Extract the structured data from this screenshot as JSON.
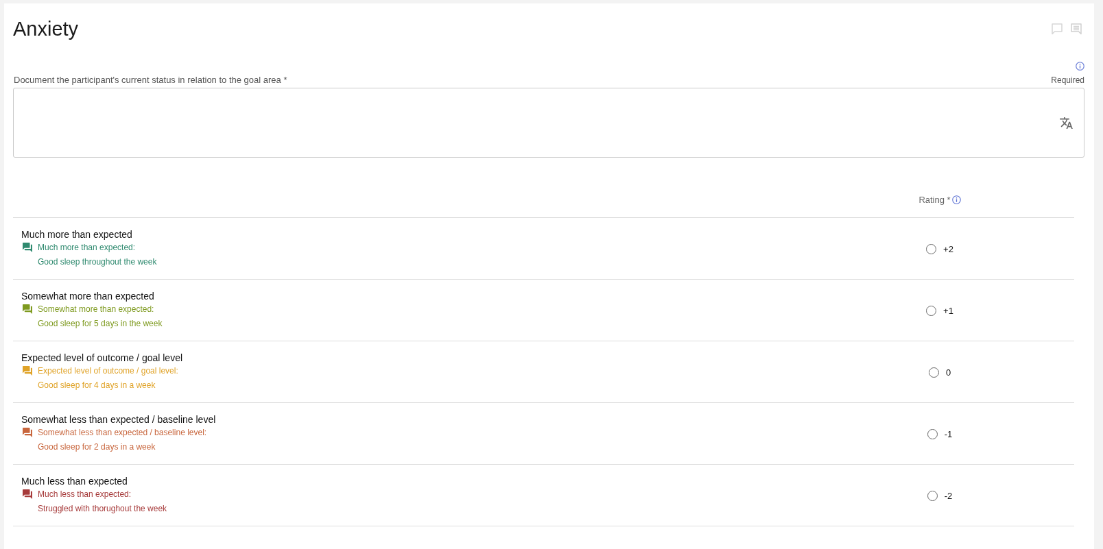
{
  "title": "Anxiety",
  "status_field": {
    "label": "Document the participant's current status in relation to the goal area *",
    "required_note": "Required"
  },
  "rating_table": {
    "column_header": "Rating *",
    "levels": [
      {
        "description": "Much more than expected",
        "note_label": "Much more than expected:",
        "note_text": "Good sleep throughout the week",
        "color": "#2f8a6f",
        "rating": {
          "label": "+2",
          "selected": false
        }
      },
      {
        "description": "Somewhat more than expected",
        "note_label": "Somewhat more than expected:",
        "note_text": "Good sleep for 5 days in the week",
        "color": "#7e9a1f",
        "rating": {
          "label": "+1",
          "selected": false
        }
      },
      {
        "description": "Expected level of outcome / goal level",
        "note_label": "Expected level of outcome / goal level:",
        "note_text": "Good sleep for 4 days in a week",
        "color": "#e0a328",
        "rating": {
          "label": "0",
          "selected": false
        }
      },
      {
        "description": "Somewhat less than expected / baseline level",
        "note_label": "Somewhat less than expected / baseline level:",
        "note_text": "Good sleep for 2 days in a week",
        "color": "#c8663d",
        "rating": {
          "label": "-1",
          "selected": false
        }
      },
      {
        "description": "Much less than expected",
        "note_label": "Much less than expected:",
        "note_text": "Struggled with thorughout the week",
        "color": "#a63a3a",
        "rating": {
          "label": "-2",
          "selected": false
        }
      }
    ]
  }
}
